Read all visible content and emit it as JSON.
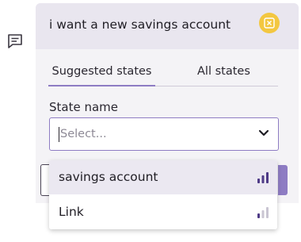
{
  "panel": {
    "message": "i want a new savings account"
  },
  "tabs": [
    {
      "label": "Suggested states",
      "active": true
    },
    {
      "label": "All states",
      "active": false
    }
  ],
  "field": {
    "label": "State name",
    "placeholder": "Select..."
  },
  "options": [
    {
      "label": "savings account",
      "strength_bars": 3,
      "highlighted": true
    },
    {
      "label": "Link",
      "strength_bars": 1,
      "highlighted": false
    }
  ],
  "colors": {
    "accent": "#8e7cc3",
    "close_button": "#f3c740",
    "header_bg": "#e9e6ef",
    "bar_strong": "#4e3a86",
    "bar_weak": "#c9c5d2"
  },
  "icons": {
    "side": "chat-icon",
    "close": "close-icon",
    "dropdown": "chevron-down-icon",
    "strength": "signal-bars-icon"
  }
}
